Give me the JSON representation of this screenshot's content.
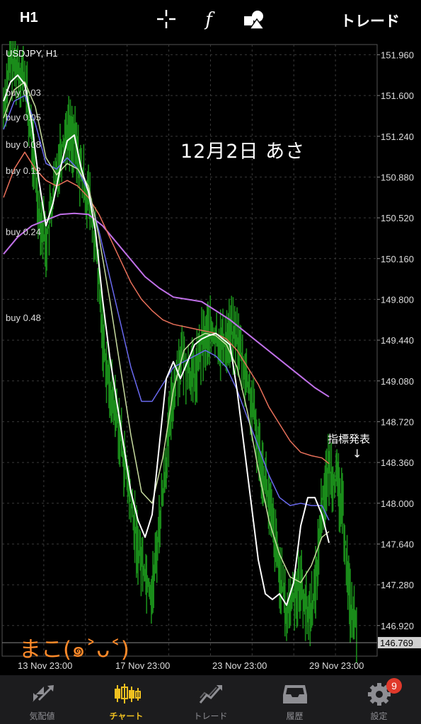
{
  "toolbar": {
    "timeframe": "H1",
    "trade_label": "トレード",
    "icons": [
      "crosshair-icon",
      "indicator-f-icon",
      "objects-icon"
    ]
  },
  "chart_data": {
    "type": "line",
    "title": "USDJPY, H1",
    "ylim": [
      146.65,
      152.05
    ],
    "y_ticks": [
      "151.960",
      "151.600",
      "151.240",
      "150.880",
      "150.520",
      "150.160",
      "149.800",
      "149.440",
      "149.080",
      "148.720",
      "148.360",
      "148.000",
      "147.640",
      "147.280",
      "146.920"
    ],
    "current_price": "146.769",
    "x_ticks": [
      "13 Nov 23:00",
      "17 Nov 23:00",
      "23 Nov 23:00",
      "29 Nov 23:00"
    ],
    "order_labels": [
      {
        "text": "buy 0.03",
        "price": 151.63
      },
      {
        "text": "buy 0.05",
        "price": 151.41
      },
      {
        "text": "buy 0.08",
        "price": 151.17
      },
      {
        "text": "buy 0.12",
        "price": 150.94
      },
      {
        "text": "buy 0.24",
        "price": 150.4
      },
      {
        "text": "buy 0.48",
        "price": 149.64
      }
    ],
    "grid": true,
    "colors": {
      "background": "#000000",
      "price": "#1a8c1a",
      "ma_fast": "#ffffff",
      "ma_mid": "#c8dca0",
      "ma_blue": "#6a6af0",
      "ma_red": "#e8705a",
      "ma_purple": "#c070e8",
      "grid": "#3a3a3a"
    },
    "series": [
      {
        "key": "price",
        "points": [
          [
            0,
            151.5
          ],
          [
            0.02,
            151.9
          ],
          [
            0.04,
            151.85
          ],
          [
            0.06,
            151.75
          ],
          [
            0.08,
            151.2
          ],
          [
            0.1,
            150.6
          ],
          [
            0.12,
            150.3
          ],
          [
            0.14,
            150.7
          ],
          [
            0.16,
            151.1
          ],
          [
            0.18,
            151.3
          ],
          [
            0.2,
            151.2
          ],
          [
            0.22,
            150.9
          ],
          [
            0.24,
            150.7
          ],
          [
            0.26,
            150.3
          ],
          [
            0.28,
            149.5
          ],
          [
            0.3,
            149.0
          ],
          [
            0.32,
            148.8
          ],
          [
            0.34,
            148.4
          ],
          [
            0.36,
            148.0
          ],
          [
            0.38,
            147.6
          ],
          [
            0.4,
            147.4
          ],
          [
            0.42,
            147.2
          ],
          [
            0.44,
            147.8
          ],
          [
            0.46,
            148.4
          ],
          [
            0.48,
            149.0
          ],
          [
            0.5,
            149.3
          ],
          [
            0.52,
            149.2
          ],
          [
            0.54,
            149.1
          ],
          [
            0.56,
            149.4
          ],
          [
            0.58,
            149.5
          ],
          [
            0.6,
            149.45
          ],
          [
            0.62,
            149.4
          ],
          [
            0.64,
            149.5
          ],
          [
            0.66,
            149.45
          ],
          [
            0.68,
            149.2
          ],
          [
            0.7,
            148.9
          ],
          [
            0.72,
            148.5
          ],
          [
            0.74,
            148.2
          ],
          [
            0.76,
            147.8
          ],
          [
            0.78,
            147.4
          ],
          [
            0.8,
            147.0
          ],
          [
            0.82,
            147.2
          ],
          [
            0.84,
            147.3
          ],
          [
            0.86,
            147.0
          ],
          [
            0.88,
            147.2
          ],
          [
            0.9,
            148.0
          ],
          [
            0.92,
            148.3
          ],
          [
            0.94,
            148.2
          ],
          [
            0.96,
            147.9
          ],
          [
            0.98,
            147.1
          ],
          [
            1.0,
            146.85
          ]
        ]
      },
      {
        "key": "ma_fast",
        "points": [
          [
            0,
            151.55
          ],
          [
            0.02,
            151.72
          ],
          [
            0.04,
            151.78
          ],
          [
            0.06,
            151.7
          ],
          [
            0.08,
            151.35
          ],
          [
            0.1,
            150.85
          ],
          [
            0.12,
            150.45
          ],
          [
            0.14,
            150.65
          ],
          [
            0.16,
            150.95
          ],
          [
            0.18,
            151.2
          ],
          [
            0.2,
            151.25
          ],
          [
            0.22,
            150.95
          ],
          [
            0.24,
            150.75
          ],
          [
            0.26,
            150.4
          ],
          [
            0.28,
            149.8
          ],
          [
            0.3,
            149.3
          ],
          [
            0.32,
            148.9
          ],
          [
            0.34,
            148.5
          ],
          [
            0.36,
            148.1
          ],
          [
            0.38,
            147.85
          ],
          [
            0.4,
            147.7
          ],
          [
            0.42,
            147.9
          ],
          [
            0.44,
            148.5
          ],
          [
            0.46,
            149.1
          ],
          [
            0.48,
            149.25
          ],
          [
            0.5,
            149.1
          ],
          [
            0.52,
            149.25
          ],
          [
            0.54,
            149.4
          ],
          [
            0.56,
            149.45
          ],
          [
            0.58,
            149.48
          ],
          [
            0.6,
            149.5
          ],
          [
            0.62,
            149.45
          ],
          [
            0.64,
            149.4
          ],
          [
            0.66,
            149.0
          ],
          [
            0.68,
            148.5
          ],
          [
            0.7,
            148.0
          ],
          [
            0.72,
            147.5
          ],
          [
            0.74,
            147.2
          ],
          [
            0.76,
            147.15
          ],
          [
            0.78,
            147.2
          ],
          [
            0.8,
            147.1
          ],
          [
            0.82,
            147.3
          ],
          [
            0.84,
            147.8
          ],
          [
            0.86,
            148.05
          ],
          [
            0.88,
            148.05
          ],
          [
            0.9,
            147.9
          ],
          [
            0.92,
            147.65
          ]
        ]
      },
      {
        "key": "ma_mid",
        "points": [
          [
            0,
            151.4
          ],
          [
            0.03,
            151.65
          ],
          [
            0.06,
            151.72
          ],
          [
            0.09,
            151.5
          ],
          [
            0.12,
            151.05
          ],
          [
            0.15,
            150.9
          ],
          [
            0.18,
            151.0
          ],
          [
            0.21,
            150.95
          ],
          [
            0.24,
            150.8
          ],
          [
            0.27,
            150.35
          ],
          [
            0.3,
            149.8
          ],
          [
            0.33,
            149.2
          ],
          [
            0.36,
            148.6
          ],
          [
            0.39,
            148.1
          ],
          [
            0.42,
            148.0
          ],
          [
            0.45,
            148.4
          ],
          [
            0.48,
            149.0
          ],
          [
            0.51,
            149.35
          ],
          [
            0.54,
            149.45
          ],
          [
            0.57,
            149.5
          ],
          [
            0.6,
            149.48
          ],
          [
            0.63,
            149.4
          ],
          [
            0.66,
            149.2
          ],
          [
            0.69,
            148.8
          ],
          [
            0.72,
            148.3
          ],
          [
            0.75,
            147.85
          ],
          [
            0.78,
            147.55
          ],
          [
            0.81,
            147.35
          ],
          [
            0.84,
            147.3
          ],
          [
            0.87,
            147.45
          ],
          [
            0.9,
            147.7
          ],
          [
            0.92,
            147.75
          ]
        ]
      },
      {
        "key": "ma_blue",
        "points": [
          [
            0,
            151.3
          ],
          [
            0.03,
            151.55
          ],
          [
            0.06,
            151.6
          ],
          [
            0.09,
            151.35
          ],
          [
            0.12,
            151.0
          ],
          [
            0.15,
            150.95
          ],
          [
            0.18,
            151.05
          ],
          [
            0.21,
            150.95
          ],
          [
            0.24,
            150.75
          ],
          [
            0.27,
            150.4
          ],
          [
            0.3,
            150.0
          ],
          [
            0.33,
            149.6
          ],
          [
            0.36,
            149.2
          ],
          [
            0.39,
            148.9
          ],
          [
            0.42,
            148.9
          ],
          [
            0.45,
            149.05
          ],
          [
            0.48,
            149.2
          ],
          [
            0.51,
            149.25
          ],
          [
            0.54,
            149.3
          ],
          [
            0.57,
            149.35
          ],
          [
            0.6,
            149.3
          ],
          [
            0.63,
            149.2
          ],
          [
            0.66,
            149.0
          ],
          [
            0.69,
            148.75
          ],
          [
            0.72,
            148.5
          ],
          [
            0.75,
            148.25
          ],
          [
            0.78,
            148.05
          ],
          [
            0.81,
            147.98
          ],
          [
            0.84,
            148.0
          ],
          [
            0.87,
            147.98
          ],
          [
            0.9,
            147.98
          ],
          [
            0.92,
            147.85
          ]
        ]
      },
      {
        "key": "ma_red",
        "points": [
          [
            0,
            150.7
          ],
          [
            0.03,
            150.95
          ],
          [
            0.06,
            151.1
          ],
          [
            0.09,
            150.95
          ],
          [
            0.12,
            150.85
          ],
          [
            0.15,
            150.8
          ],
          [
            0.18,
            150.85
          ],
          [
            0.21,
            150.8
          ],
          [
            0.24,
            150.7
          ],
          [
            0.27,
            150.55
          ],
          [
            0.3,
            150.35
          ],
          [
            0.33,
            150.15
          ],
          [
            0.36,
            149.95
          ],
          [
            0.39,
            149.8
          ],
          [
            0.42,
            149.7
          ],
          [
            0.45,
            149.62
          ],
          [
            0.48,
            149.58
          ],
          [
            0.51,
            149.56
          ],
          [
            0.54,
            149.54
          ],
          [
            0.57,
            149.52
          ],
          [
            0.6,
            149.5
          ],
          [
            0.63,
            149.45
          ],
          [
            0.66,
            149.35
          ],
          [
            0.69,
            149.2
          ],
          [
            0.72,
            149.05
          ],
          [
            0.75,
            148.85
          ],
          [
            0.78,
            148.7
          ],
          [
            0.81,
            148.55
          ],
          [
            0.84,
            148.45
          ],
          [
            0.87,
            148.42
          ],
          [
            0.9,
            148.4
          ],
          [
            0.92,
            148.35
          ]
        ]
      },
      {
        "key": "ma_purple",
        "points": [
          [
            0,
            150.2
          ],
          [
            0.04,
            150.35
          ],
          [
            0.08,
            150.45
          ],
          [
            0.12,
            150.5
          ],
          [
            0.16,
            150.55
          ],
          [
            0.2,
            150.56
          ],
          [
            0.24,
            150.55
          ],
          [
            0.28,
            150.45
          ],
          [
            0.32,
            150.3
          ],
          [
            0.36,
            150.15
          ],
          [
            0.4,
            150.0
          ],
          [
            0.44,
            149.9
          ],
          [
            0.48,
            149.82
          ],
          [
            0.52,
            149.8
          ],
          [
            0.56,
            149.78
          ],
          [
            0.6,
            149.7
          ],
          [
            0.64,
            149.62
          ],
          [
            0.68,
            149.52
          ],
          [
            0.72,
            149.42
          ],
          [
            0.76,
            149.32
          ],
          [
            0.8,
            149.22
          ],
          [
            0.84,
            149.12
          ],
          [
            0.88,
            149.02
          ],
          [
            0.92,
            148.94
          ]
        ]
      }
    ]
  },
  "annotations": {
    "date_note": "12月2日 あさ",
    "indicator_note": "指標発表",
    "arrow": "↓",
    "signature": "まこ(๑˃ᴗ˂)"
  },
  "tabs": [
    {
      "label": "気配値",
      "icon": "quotes-arrow-icon"
    },
    {
      "label": "チャート",
      "icon": "candlestick-icon"
    },
    {
      "label": "トレード",
      "icon": "trade-chart-icon"
    },
    {
      "label": "履歴",
      "icon": "inbox-history-icon"
    },
    {
      "label": "設定",
      "icon": "gear-icon",
      "badge": "9"
    }
  ]
}
